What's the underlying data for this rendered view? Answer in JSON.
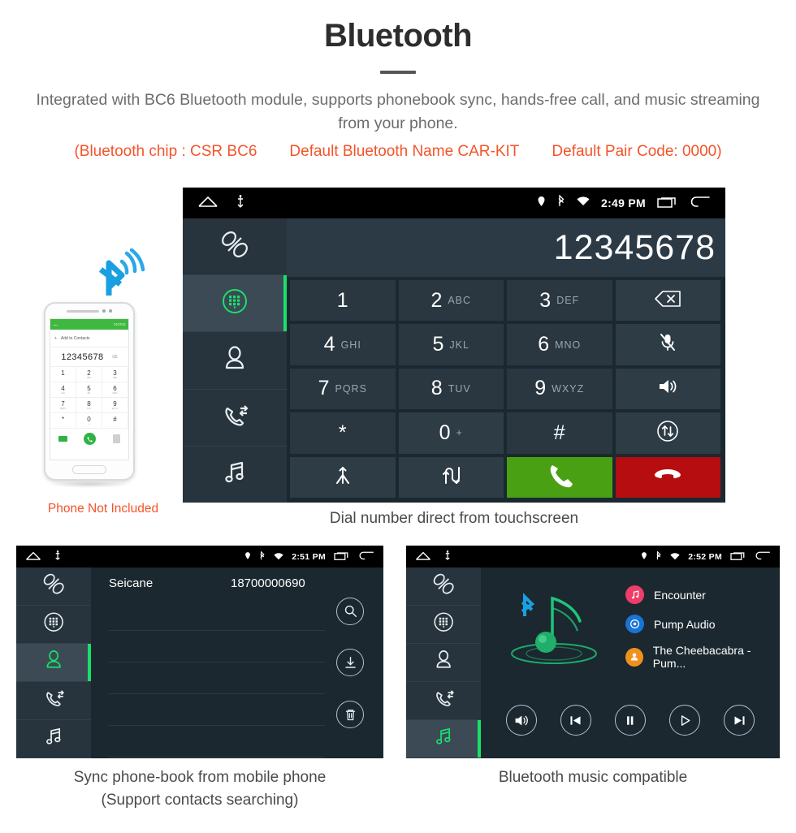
{
  "header": {
    "title": "Bluetooth",
    "description": "Integrated with BC6 Bluetooth module, supports phonebook sync, hands-free call, and music streaming from your phone.",
    "spec_chip": "(Bluetooth chip : CSR BC6",
    "spec_name": "Default Bluetooth Name CAR-KIT",
    "spec_pair": "Default Pair Code: 0000)",
    "accent_red": "#f4542a",
    "body_gray": "#6d6d6d"
  },
  "phone_mock": {
    "status_note": "Phone Not Included",
    "screen": {
      "back_icon": "←",
      "more_label": "MORE",
      "add_contacts": "Add to Contacts",
      "add_icon": "+",
      "number": "12345678",
      "backspace_icon": "⌫",
      "keys": [
        {
          "digit": "1",
          "letters": ""
        },
        {
          "digit": "2",
          "letters": "ABC"
        },
        {
          "digit": "3",
          "letters": "DEF"
        },
        {
          "digit": "4",
          "letters": "GHI"
        },
        {
          "digit": "5",
          "letters": "JKL"
        },
        {
          "digit": "6",
          "letters": "MNO"
        },
        {
          "digit": "7",
          "letters": "PQRS"
        },
        {
          "digit": "8",
          "letters": "TUV"
        },
        {
          "digit": "9",
          "letters": "WXYZ"
        },
        {
          "digit": "*",
          "letters": ""
        },
        {
          "digit": "0",
          "letters": "+"
        },
        {
          "digit": "#",
          "letters": ""
        }
      ],
      "call_icon": "✆",
      "green": "#3fb83f"
    },
    "bluetooth_icon_color": "#1a9fe0"
  },
  "main_screen": {
    "statusbar": {
      "home_icon": "home-icon",
      "usb_icon": "usb-icon",
      "location_icon": "location-pin-icon",
      "bluetooth_icon": "bluetooth-icon",
      "wifi_icon": "wifi-icon",
      "time": "2:49 PM",
      "recents_icon": "recents-icon",
      "back_icon": "back-arrow-icon"
    },
    "sidebar": [
      {
        "name": "pair-link",
        "active": false
      },
      {
        "name": "dialpad",
        "active": true
      },
      {
        "name": "contacts",
        "active": false
      },
      {
        "name": "call-history",
        "active": false
      },
      {
        "name": "music",
        "active": false
      }
    ],
    "dialed_number": "12345678",
    "keypad": [
      {
        "digit": "1",
        "letters": "",
        "kind": "digit"
      },
      {
        "digit": "2",
        "letters": "ABC",
        "kind": "digit"
      },
      {
        "digit": "3",
        "letters": "DEF",
        "kind": "digit"
      },
      {
        "icon": "backspace-icon",
        "kind": "icon"
      },
      {
        "digit": "4",
        "letters": "GHI",
        "kind": "digit"
      },
      {
        "digit": "5",
        "letters": "JKL",
        "kind": "digit"
      },
      {
        "digit": "6",
        "letters": "MNO",
        "kind": "digit"
      },
      {
        "icon": "mic-mute-icon",
        "kind": "icon"
      },
      {
        "digit": "7",
        "letters": "PQRS",
        "kind": "digit"
      },
      {
        "digit": "8",
        "letters": "TUV",
        "kind": "digit"
      },
      {
        "digit": "9",
        "letters": "WXYZ",
        "kind": "digit"
      },
      {
        "icon": "speaker-icon",
        "kind": "icon"
      },
      {
        "digit": "*",
        "letters": "",
        "kind": "digit"
      },
      {
        "digit": "0",
        "letters": "+",
        "kind": "digit"
      },
      {
        "digit": "#",
        "letters": "",
        "kind": "digit"
      },
      {
        "icon": "transfer-audio-icon",
        "kind": "icon"
      },
      {
        "icon": "merge-call-icon",
        "kind": "icon"
      },
      {
        "icon": "swap-call-icon",
        "kind": "icon"
      },
      {
        "icon": "call-answer-icon",
        "kind": "icon"
      },
      {
        "icon": "call-end-icon",
        "kind": "icon"
      }
    ],
    "caption": "Dial number direct from touchscreen",
    "colors": {
      "call_green": "#4aa013",
      "hangup_red": "#b60d10",
      "active_green": "#19e06a"
    }
  },
  "phonebook_screen": {
    "statusbar": {
      "time": "2:51 PM"
    },
    "sidebar_active": "contacts",
    "contacts": [
      {
        "name": "Seicane",
        "number": "18700000690"
      }
    ],
    "empty_rows": 5,
    "actions": [
      {
        "name": "search-contacts",
        "icon": "search-icon"
      },
      {
        "name": "download-phonebook",
        "icon": "download-icon"
      },
      {
        "name": "delete-contacts",
        "icon": "trash-icon"
      }
    ],
    "caption_line1": "Sync phone-book from mobile phone",
    "caption_line2": "(Support contacts searching)"
  },
  "music_screen": {
    "statusbar": {
      "time": "2:52 PM"
    },
    "sidebar_active": "music",
    "tracks": [
      {
        "label": "Encounter",
        "icon": "music-note-icon",
        "color": "#ef3d6a"
      },
      {
        "label": "Pump Audio",
        "icon": "album-icon",
        "color": "#1a73d6"
      },
      {
        "label": "The Cheebacabra - Pum...",
        "icon": "artist-icon",
        "color": "#f0911e"
      }
    ],
    "controls": [
      {
        "name": "volume-button",
        "icon": "speaker-icon"
      },
      {
        "name": "previous-button",
        "icon": "skip-back-icon"
      },
      {
        "name": "pause-button",
        "icon": "pause-icon"
      },
      {
        "name": "play-button",
        "icon": "play-icon"
      },
      {
        "name": "next-button",
        "icon": "skip-forward-icon"
      }
    ],
    "caption": "Bluetooth music compatible"
  }
}
